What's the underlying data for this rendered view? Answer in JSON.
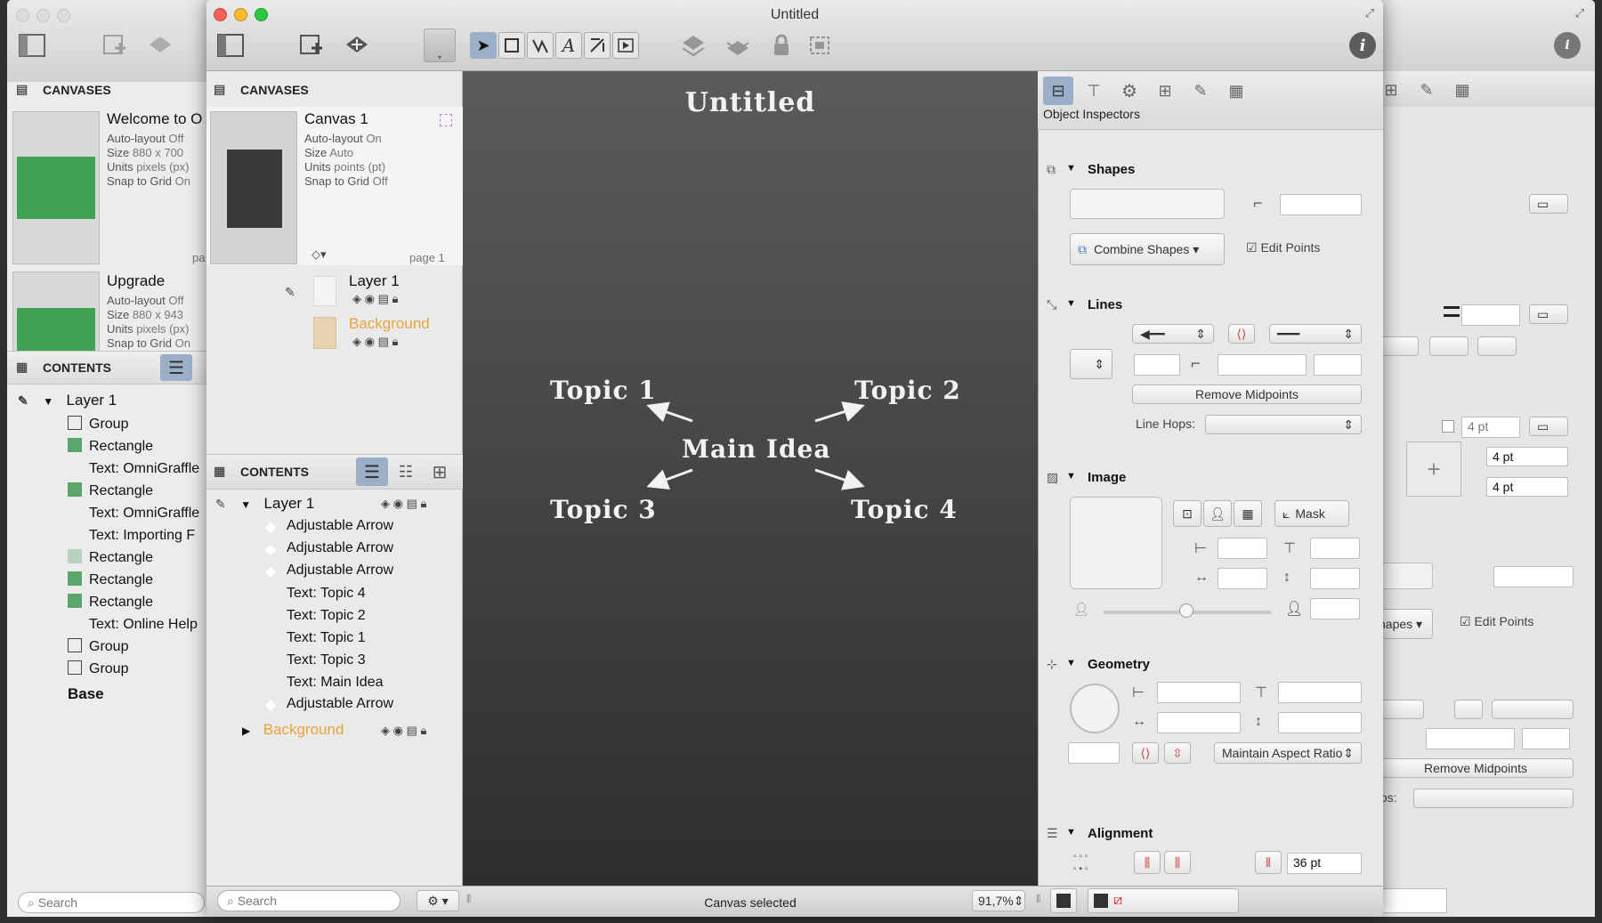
{
  "app": {
    "window_title": "Untitled"
  },
  "back_window": {
    "canvases_header": "CANVASES",
    "canvases": [
      {
        "name": "Welcome to O",
        "autolayout_label": "Auto-layout",
        "autolayout": "Off",
        "size_label": "Size",
        "size": "880 x 700",
        "units_label": "Units",
        "units": "pixels (px)",
        "snap_label": "Snap to Grid",
        "snap": "On",
        "page": "pa"
      },
      {
        "name": "Upgrade",
        "autolayout_label": "Auto-layout",
        "autolayout": "Off",
        "size_label": "Size",
        "size": "880 x 943",
        "units_label": "Units",
        "units": "pixels (px)",
        "snap_label": "Snap to Grid",
        "snap": "On"
      }
    ],
    "contents_header": "CONTENTS",
    "layer": "Layer 1",
    "items": [
      "Group",
      "Rectangle",
      "Text: OmniGraffle",
      "Rectangle",
      "Text: OmniGraffle",
      "Text: Importing F",
      "Rectangle",
      "Rectangle",
      "Rectangle",
      "Text: Online Help",
      "Group",
      "Group"
    ],
    "base": "Base",
    "search_placeholder": "Search",
    "inspector": {
      "four_pt_1": "4 pt",
      "four_pt_2": "4 pt",
      "four_pt_3": "4 pt",
      "shapes_btn": "hapes",
      "edit_points": "Edit Points",
      "remove_midpoints": "Remove Midpoints",
      "hops": "lops:"
    }
  },
  "sidebar": {
    "canvases_header": "CANVASES",
    "canvas": {
      "name": "Canvas 1",
      "autolayout_label": "Auto-layout",
      "autolayout": "On",
      "size_label": "Size",
      "size": "Auto",
      "units_label": "Units",
      "units": "points (pt)",
      "snap_label": "Snap to Grid",
      "snap": "Off",
      "page": "page 1"
    },
    "layers": [
      {
        "name": "Layer 1"
      },
      {
        "name": "Background"
      }
    ],
    "contents_header": "CONTENTS",
    "layer": "Layer 1",
    "items": [
      "Adjustable Arrow",
      "Adjustable Arrow",
      "Adjustable Arrow",
      "Text: Topic 4",
      "Text: Topic 2",
      "Text: Topic 1",
      "Text: Topic 3",
      "Text: Main Idea",
      "Adjustable Arrow"
    ],
    "background": "Background",
    "search_placeholder": "Search"
  },
  "canvas": {
    "title": "Untitled",
    "main": "Main Idea",
    "topics": [
      "Topic 1",
      "Topic 2",
      "Topic 3",
      "Topic 4"
    ],
    "colors": {
      "bg_top": "#5b5b5b",
      "bg_bottom": "#2e2e2e",
      "text": "#f2f2f2"
    }
  },
  "inspector": {
    "label": "Object Inspectors",
    "shapes": {
      "title": "Shapes",
      "combine": "Combine Shapes",
      "edit_points": "Edit Points"
    },
    "lines": {
      "title": "Lines",
      "remove_midpoints": "Remove Midpoints",
      "line_hops": "Line Hops:"
    },
    "image": {
      "title": "Image",
      "mask": "Mask"
    },
    "geometry": {
      "title": "Geometry",
      "aspect": "Maintain Aspect Ratio"
    },
    "alignment": {
      "title": "Alignment",
      "spacing": "36 pt"
    }
  },
  "status": {
    "text": "Canvas selected",
    "zoom": "91,7%"
  },
  "accent": {
    "background_layer": "#e8a43c",
    "selection": "#9bb0c8"
  }
}
